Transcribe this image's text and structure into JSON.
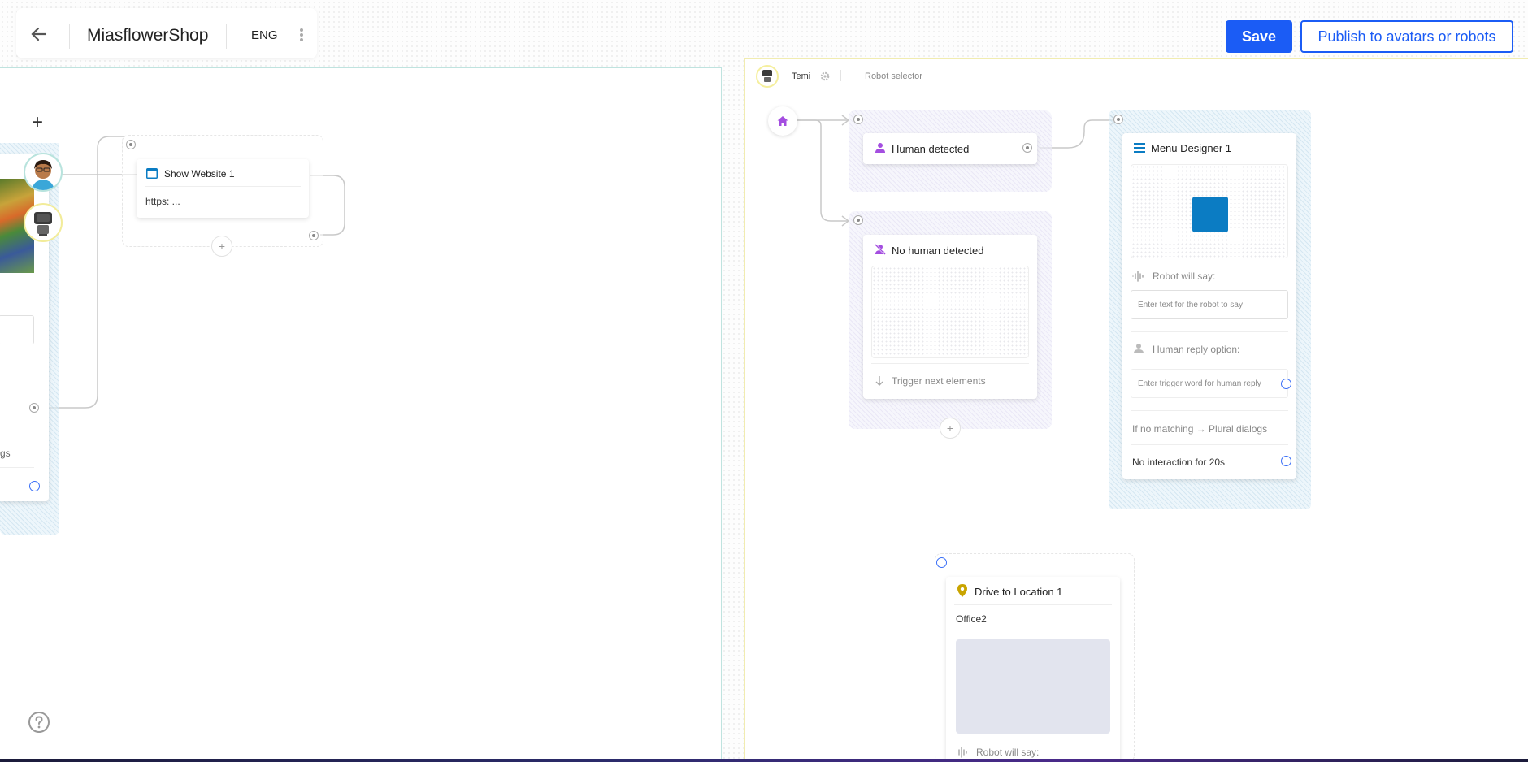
{
  "header": {
    "shop_title": "MiasflowerShop",
    "language": "ENG",
    "save_label": "Save",
    "publish_label": "Publish to avatars or robots"
  },
  "left_canvas": {
    "show_website": {
      "title": "Show Website 1",
      "url": "https: ..."
    },
    "partial_text": "gs",
    "add_label": "+"
  },
  "right_canvas": {
    "robot_name": "Temi",
    "robot_selector_label": "Robot selector",
    "human_detected": {
      "title": "Human detected"
    },
    "no_human_detected": {
      "title": "No human detected",
      "trigger_label": "Trigger next elements"
    },
    "menu_designer": {
      "title": "Menu Designer 1",
      "robot_say_label": "Robot will say:",
      "robot_say_placeholder": "Enter text for the robot to say",
      "human_reply_label": "Human reply option:",
      "human_reply_placeholder": "Enter trigger word for human reply",
      "no_match_label": "If no matching → Plural dialogs",
      "no_interaction_label": "No interaction for 20s"
    },
    "drive_location": {
      "title": "Drive to Location 1",
      "location": "Office2",
      "robot_say_label": "Robot will say:"
    }
  },
  "colors": {
    "accent": "#1b5cf5",
    "purple_icon": "#a44ee0",
    "menu_blue": "#0b7cc3",
    "location_gold": "#c9a400"
  },
  "icons": {
    "back": "arrow-left-icon",
    "kebab": "kebab-menu-icon",
    "home": "home-icon",
    "help": "help-icon",
    "gear": "gear-icon"
  }
}
